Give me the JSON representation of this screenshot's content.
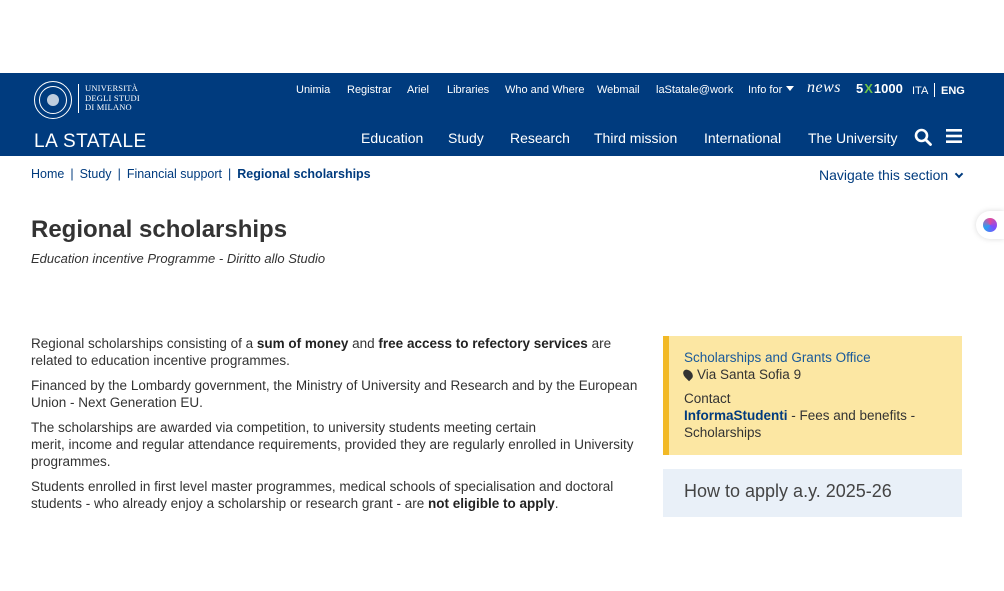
{
  "header": {
    "university_name": [
      "UNIVERSITÀ",
      "DEGLI STUDI",
      "DI MILANO"
    ],
    "brand": "LA STATALE",
    "utility_nav": [
      "Unimia",
      "Registrar",
      "Ariel",
      "Libraries",
      "Who and Where",
      "Webmail",
      "laStatale@work",
      "Info for"
    ],
    "news_label": "news",
    "five_per_mille": {
      "prefix": "5",
      "x": "X",
      "suffix": "1000"
    },
    "languages": {
      "ita": "ITA",
      "eng": "ENG",
      "active": "ENG"
    },
    "main_nav": [
      "Education",
      "Study",
      "Research",
      "Third mission",
      "International",
      "The University"
    ],
    "colors": {
      "header_bg": "#003b7e",
      "accent_green": "#6cc24a"
    }
  },
  "breadcrumb": [
    "Home",
    "Study",
    "Financial support",
    "Regional scholarships"
  ],
  "section_nav_label": "Navigate this section",
  "page": {
    "title": "Regional scholarships",
    "subtitle": "Education incentive Programme - Diritto allo Studio"
  },
  "content": {
    "p1": {
      "a": "Regional scholarships consisting of a ",
      "b1": "sum of money",
      "c": " and ",
      "b2": "free access to refectory services",
      "d": " are related to education incentive programmes."
    },
    "p2": "Financed by the Lombardy government, the Ministry of University and Research and by the European Union - Next Generation EU.",
    "p3": {
      "line1": "The scholarships are awarded via competition, to university students meeting certain",
      "line2": "merit, income and regular attendance requirements, provided they are regularly enrolled in University programmes."
    },
    "p4": {
      "a": "Students enrolled in first level master programmes, medical schools of specialisation and doctoral students - who already enjoy a scholarship or research grant - are ",
      "b": "not eligible to apply",
      "c": "."
    }
  },
  "info_box": {
    "office": "Scholarships and Grants Office",
    "address": "Via Santa Sofia 9",
    "contact_label": "Contact",
    "contact_link": "InformaStudenti",
    "contact_rest": " - Fees and benefits - Scholarships",
    "colors": {
      "bg": "#fce7a3",
      "border": "#f2b926"
    }
  },
  "apply_box": {
    "label": "How to apply a.y. 2025-26"
  }
}
